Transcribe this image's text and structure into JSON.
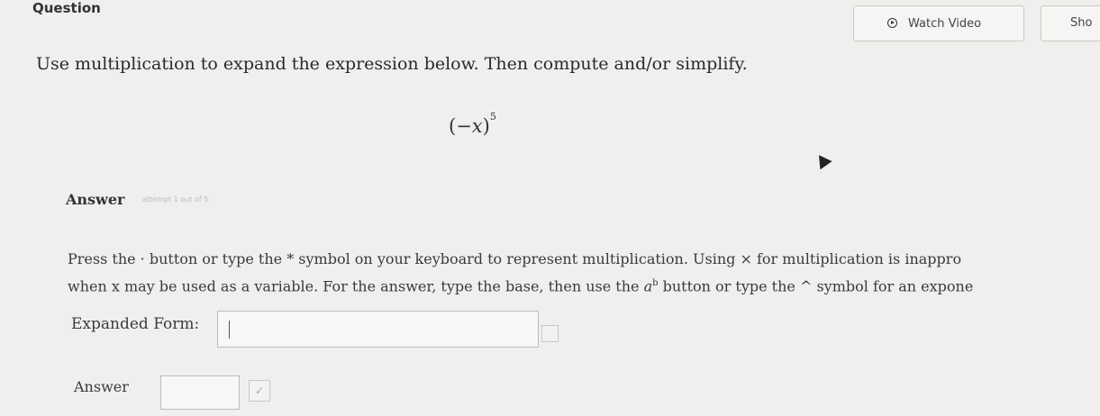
{
  "header": {
    "question_label": "Question",
    "watch_video_label": "Watch Video",
    "show_label": "Sho"
  },
  "question": {
    "prompt": "Use multiplication to expand the expression below. Then compute and/or simplify.",
    "expression_base": "−x",
    "expression_exponent": "5"
  },
  "answer_section": {
    "heading": "Answer",
    "hint": "attempt 1 out of 5",
    "instructions_line1": "Press the · button or type the * symbol on your keyboard to represent multiplication. Using × for multiplication is inappro",
    "instructions_line2_a": "when x may be used as a variable. For the answer, type the base, then use the ",
    "instructions_line2_sup_base": "a",
    "instructions_line2_sup_exp": "b",
    "instructions_line2_b": " button or type the ^ symbol for an expone",
    "expanded_label": "Expanded Form:",
    "expanded_value": "",
    "answer_label": "Answer",
    "answer_value": "",
    "check_icon_glyph": "✓"
  }
}
